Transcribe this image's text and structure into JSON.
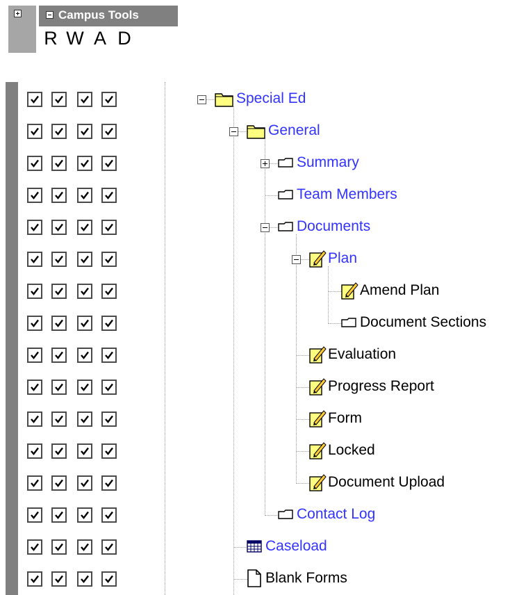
{
  "header": {
    "title": "Campus Tools",
    "permissions": [
      "R",
      "W",
      "A",
      "D"
    ]
  },
  "colors": {
    "header_bar": "#808080",
    "link": "#3333ff",
    "folder_yellow": "#ffff80"
  },
  "tree": [
    {
      "label": "Special Ed",
      "depth": 0,
      "icon": "folder-open-icon",
      "toggle": "minus",
      "link": true
    },
    {
      "label": "General",
      "depth": 1,
      "icon": "folder-open-icon",
      "toggle": "minus",
      "link": true
    },
    {
      "label": "Summary",
      "depth": 2,
      "icon": "page-tab-icon",
      "toggle": "plus",
      "link": true
    },
    {
      "label": "Team Members",
      "depth": 2,
      "icon": "page-tab-icon",
      "toggle": "none",
      "link": true
    },
    {
      "label": "Documents",
      "depth": 2,
      "icon": "page-tab-icon",
      "toggle": "minus",
      "link": true
    },
    {
      "label": "Plan",
      "depth": 3,
      "icon": "edit-form-icon",
      "toggle": "minus",
      "link": true
    },
    {
      "label": "Amend Plan",
      "depth": 4,
      "icon": "edit-form-icon",
      "toggle": "none",
      "link": false
    },
    {
      "label": "Document Sections",
      "depth": 4,
      "icon": "page-tab-icon",
      "toggle": "none",
      "link": false
    },
    {
      "label": "Evaluation",
      "depth": 3,
      "icon": "edit-form-icon",
      "toggle": "none",
      "link": false
    },
    {
      "label": "Progress Report",
      "depth": 3,
      "icon": "edit-form-icon",
      "toggle": "none",
      "link": false
    },
    {
      "label": "Form",
      "depth": 3,
      "icon": "edit-form-icon",
      "toggle": "none",
      "link": false
    },
    {
      "label": "Locked",
      "depth": 3,
      "icon": "edit-form-icon",
      "toggle": "none",
      "link": false
    },
    {
      "label": "Document Upload",
      "depth": 3,
      "icon": "edit-form-icon",
      "toggle": "none",
      "link": false
    },
    {
      "label": "Contact Log",
      "depth": 2,
      "icon": "page-tab-icon",
      "toggle": "none",
      "link": true
    },
    {
      "label": "Caseload",
      "depth": 1,
      "icon": "grid-table-icon",
      "toggle": "none",
      "link": true
    },
    {
      "label": "Blank Forms",
      "depth": 1,
      "icon": "blank-page-icon",
      "toggle": "none",
      "link": false
    }
  ],
  "checked": [
    [
      true,
      true,
      true,
      true
    ],
    [
      true,
      true,
      true,
      true
    ],
    [
      true,
      true,
      true,
      true
    ],
    [
      true,
      true,
      true,
      true
    ],
    [
      true,
      true,
      true,
      true
    ],
    [
      true,
      true,
      true,
      true
    ],
    [
      true,
      true,
      true,
      true
    ],
    [
      true,
      true,
      true,
      true
    ],
    [
      true,
      true,
      true,
      true
    ],
    [
      true,
      true,
      true,
      true
    ],
    [
      true,
      true,
      true,
      true
    ],
    [
      true,
      true,
      true,
      true
    ],
    [
      true,
      true,
      true,
      true
    ],
    [
      true,
      true,
      true,
      true
    ],
    [
      true,
      true,
      true,
      true
    ],
    [
      true,
      true,
      true,
      true
    ]
  ]
}
